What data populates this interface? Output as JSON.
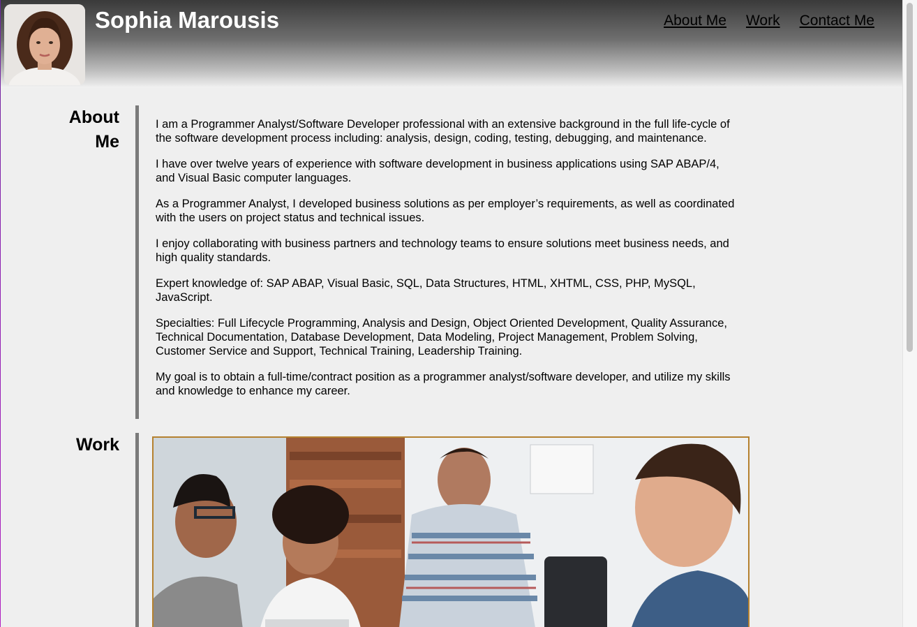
{
  "header": {
    "name": "Sophia Marousis",
    "nav": [
      "About Me",
      "Work",
      "Contact Me"
    ]
  },
  "about": {
    "heading_line1": "About",
    "heading_line2": "Me",
    "paragraphs": [
      "I am a Programmer Analyst/Software Developer professional with an extensive background in the full life-cycle of the software development process including: analysis, design, coding, testing, debugging, and maintenance.",
      "I have over twelve years of experience with software development in business applications using SAP ABAP/4, and Visual Basic computer languages.",
      "As a Programmer Analyst, I developed business solutions as per employer’s requirements, as well as coordinated with the users on project status and technical issues.",
      "I enjoy collaborating with business partners and technology teams to ensure solutions meet business needs, and high quality standards.",
      "Expert knowledge of: SAP ABAP, Visual Basic, SQL, Data Structures, HTML, XHTML, CSS, PHP, MySQL, JavaScript.",
      "Specialties: Full Lifecycle Programming, Analysis and Design, Object Oriented Development, Quality Assurance, Technical Documentation, Database Development, Data Modeling, Project Management, Problem Solving, Customer Service and Support, Technical Training, Leadership Training.",
      "My goal is to obtain a full-time/contract position as a programmer analyst/software developer, and utilize my skills and knowledge to enhance my career."
    ]
  },
  "work": {
    "heading": "Work"
  },
  "colors": {
    "accent_border": "#b5812f",
    "divider": "#7a7a7a",
    "background": "#efefef"
  }
}
